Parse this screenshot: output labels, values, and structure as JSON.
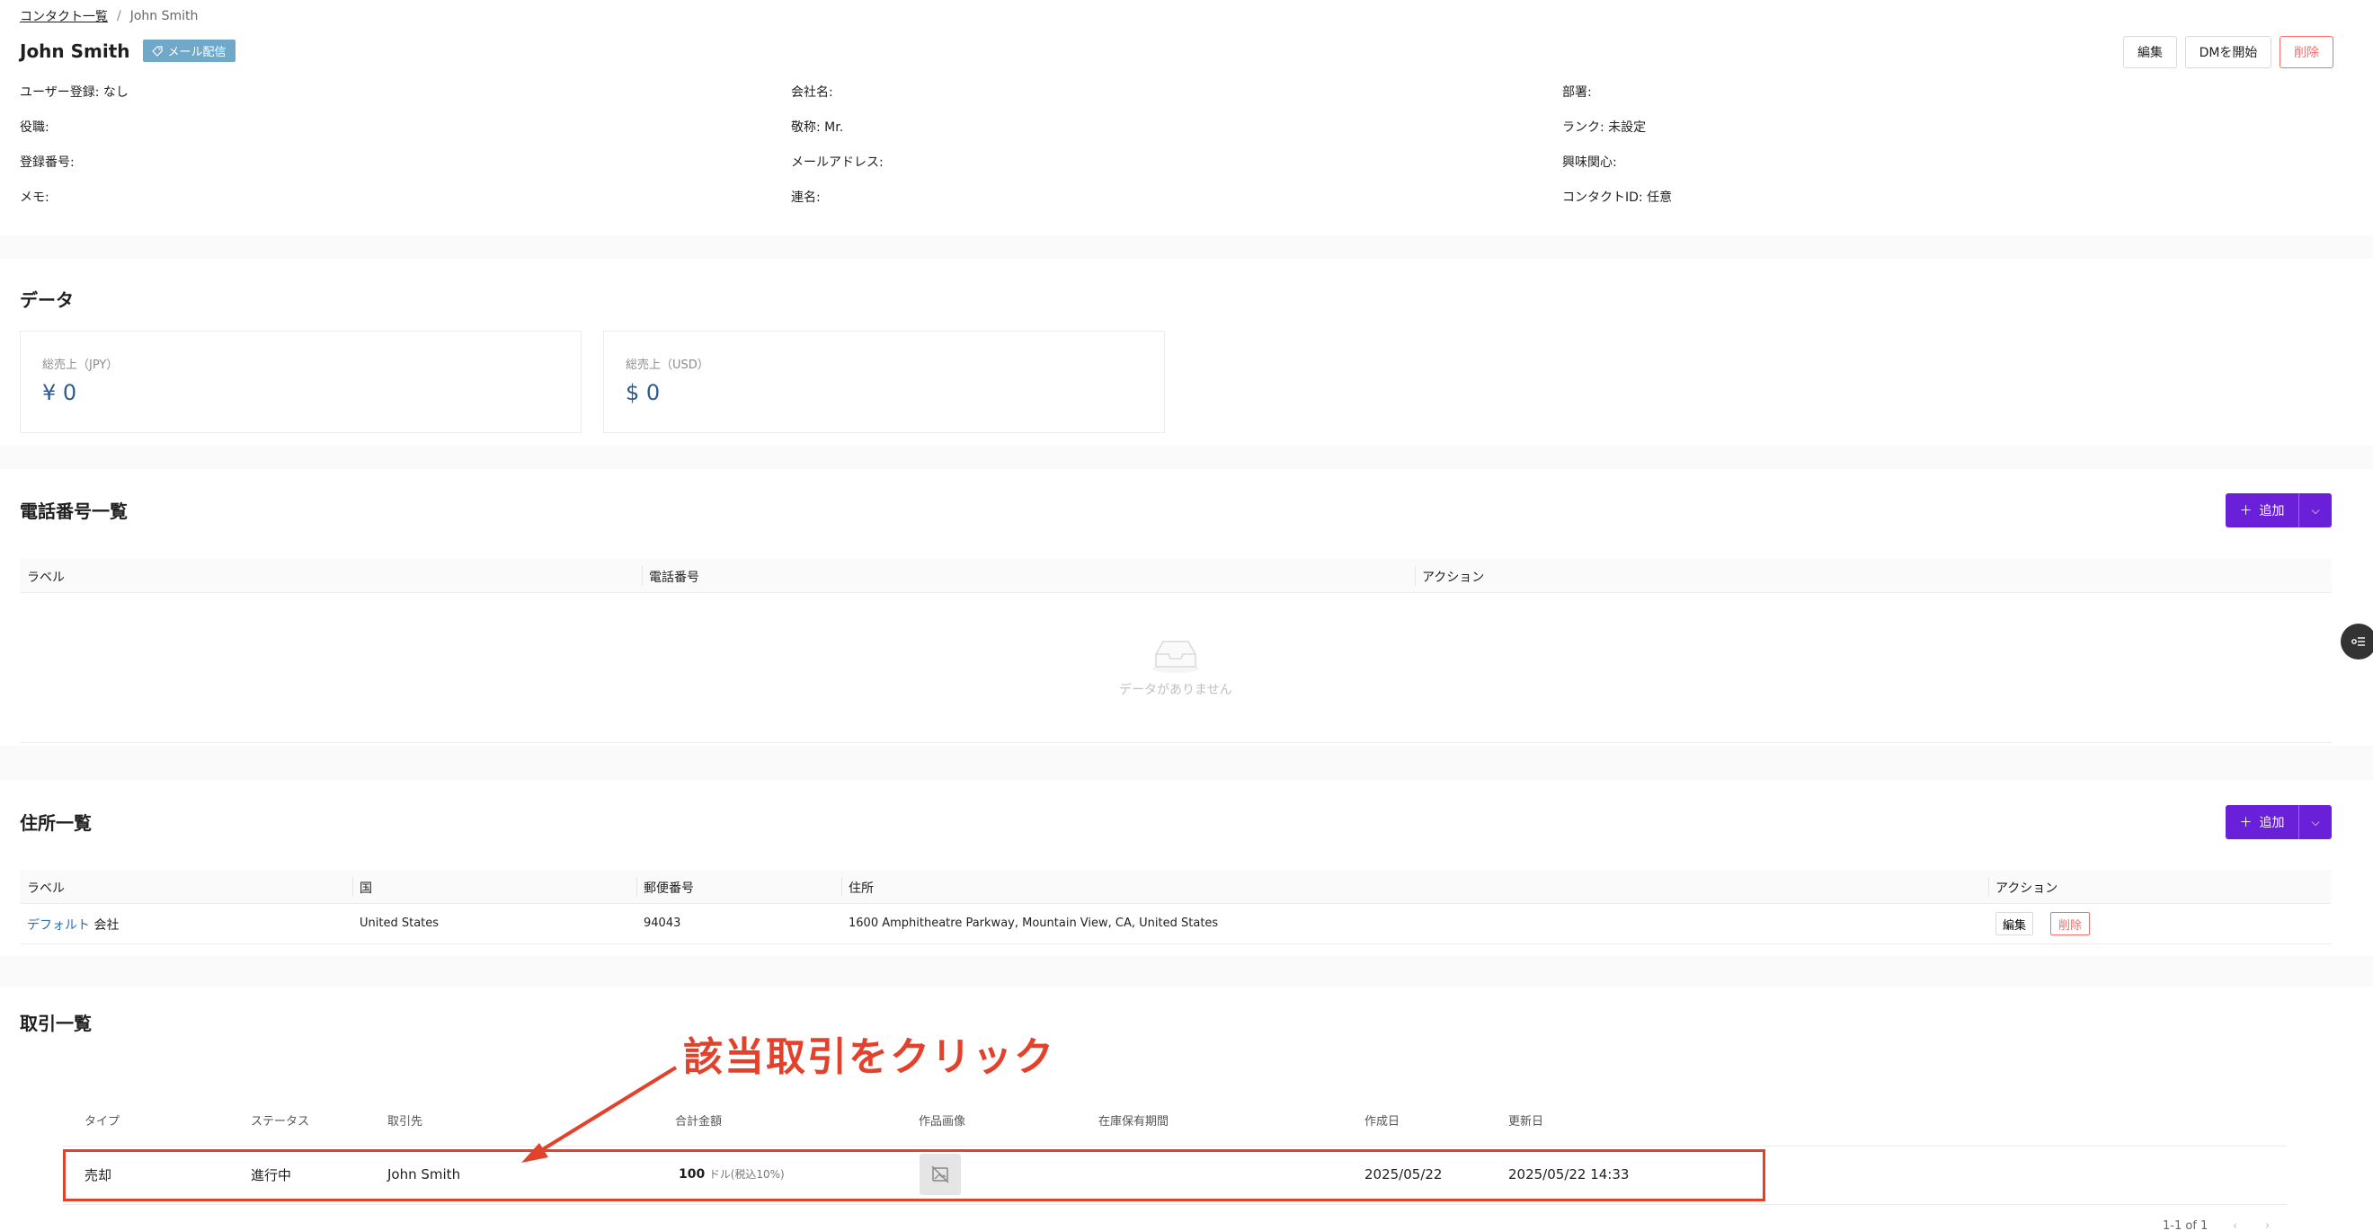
{
  "breadcrumb": {
    "parent": "コンタクト一覧",
    "separator": "/",
    "current": "John Smith"
  },
  "header": {
    "title": "John Smith",
    "badge": "メール配信",
    "edit_label": "編集",
    "dm_label": "DMを開始",
    "delete_label": "削除"
  },
  "info": [
    "ユーザー登録: なし",
    "会社名:",
    "部署:",
    "役職:",
    "敬称: Mr.",
    "ランク: 未設定",
    "登録番号:",
    "メールアドレス:",
    "興味関心:",
    "メモ:",
    "連名:",
    "コンタクトID: 任意"
  ],
  "data_section": {
    "title": "データ",
    "cards": [
      {
        "label": "総売上（JPY）",
        "value": "¥ 0"
      },
      {
        "label": "総売上（USD）",
        "value": "$ 0"
      }
    ]
  },
  "phones": {
    "title": "電話番号一覧",
    "add_label": "追加",
    "columns": [
      "ラベル",
      "電話番号",
      "アクション"
    ],
    "empty_text": "データがありません"
  },
  "addresses": {
    "title": "住所一覧",
    "add_label": "追加",
    "columns": [
      "ラベル",
      "国",
      "郵便番号",
      "住所",
      "アクション"
    ],
    "rows": [
      {
        "label_link": "デフォルト",
        "label_text": "会社",
        "country": "United States",
        "zip": "94043",
        "address": "1600 Amphitheatre Parkway, Mountain View, CA, United States",
        "edit": "編集",
        "delete": "削除"
      }
    ]
  },
  "deals": {
    "title": "取引一覧",
    "columns": [
      "タイプ",
      "ステータス",
      "取引先",
      "合計金額",
      "作品画像",
      "在庫保有期間",
      "作成日",
      "更新日"
    ],
    "rows": [
      {
        "type": "売却",
        "status": "進行中",
        "partner": "John Smith",
        "amount": "100",
        "amount_unit": "ドル(税込10%)",
        "stock_period": "",
        "created": "2025/05/22",
        "updated": "2025/05/22 14:33"
      }
    ],
    "pager": "1-1 of 1"
  },
  "annotation": "該当取引をクリック"
}
